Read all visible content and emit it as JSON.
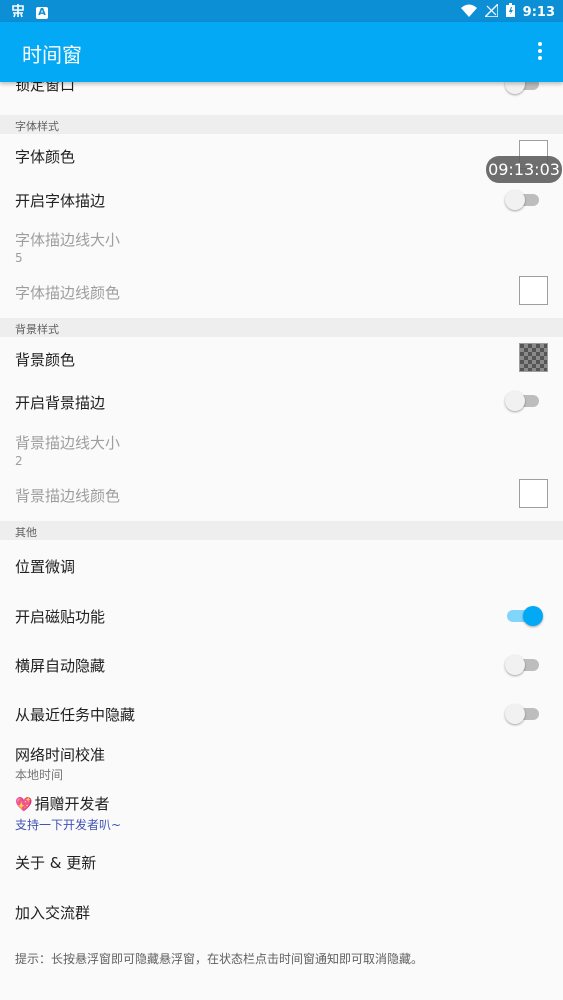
{
  "status_bar": {
    "time": "9:13",
    "left_icons": [
      "bug-icon",
      "a-icon"
    ],
    "right_icons": [
      "wifi-icon",
      "signal-icon",
      "battery-icon"
    ]
  },
  "app_bar": {
    "title": "时间窗",
    "menu_icon": "more-vert-icon"
  },
  "floating_clock": {
    "text": "09:13:03"
  },
  "rows": {
    "lock_window": {
      "label": "锁定窗口",
      "toggle_on": false
    },
    "font_color": {
      "label": "字体颜色",
      "swatch_color": "#ffffff"
    },
    "font_stroke": {
      "label": "开启字体描边",
      "toggle_on": false
    },
    "font_stroke_size": {
      "label": "字体描边线大小",
      "value": "5"
    },
    "font_stroke_color": {
      "label": "字体描边线颜色",
      "swatch_color": "#ffffff"
    },
    "bg_color": {
      "label": "背景颜色",
      "swatch_color": "transparent"
    },
    "bg_stroke": {
      "label": "开启背景描边",
      "toggle_on": false
    },
    "bg_stroke_size": {
      "label": "背景描边线大小",
      "value": "2"
    },
    "bg_stroke_color": {
      "label": "背景描边线颜色",
      "swatch_color": "#ffffff"
    },
    "position_adjust": {
      "label": "位置微调"
    },
    "magnet": {
      "label": "开启磁贴功能",
      "toggle_on": true
    },
    "landscape_hide": {
      "label": "横屏自动隐藏",
      "toggle_on": false
    },
    "recents_hide": {
      "label": "从最近任务中隐藏",
      "toggle_on": false
    },
    "network_time": {
      "label": "网络时间校准",
      "value": "本地时间"
    },
    "donate": {
      "label": "捐赠开发者",
      "sub": "支持一下开发者叭~",
      "icon": "heart-icon"
    },
    "about": {
      "label": "关于 & 更新"
    },
    "join_group": {
      "label": "加入交流群"
    }
  },
  "sections": {
    "font_style": "字体样式",
    "background_style": "背景样式",
    "other": "其他"
  },
  "hint": "提示：长按悬浮窗即可隐藏悬浮窗，在状态栏点击时间窗通知即可取消隐藏。",
  "colors": {
    "primary": "#03a9f4",
    "status_bar": "#0d8fd6",
    "accent": "#03a9f4"
  }
}
